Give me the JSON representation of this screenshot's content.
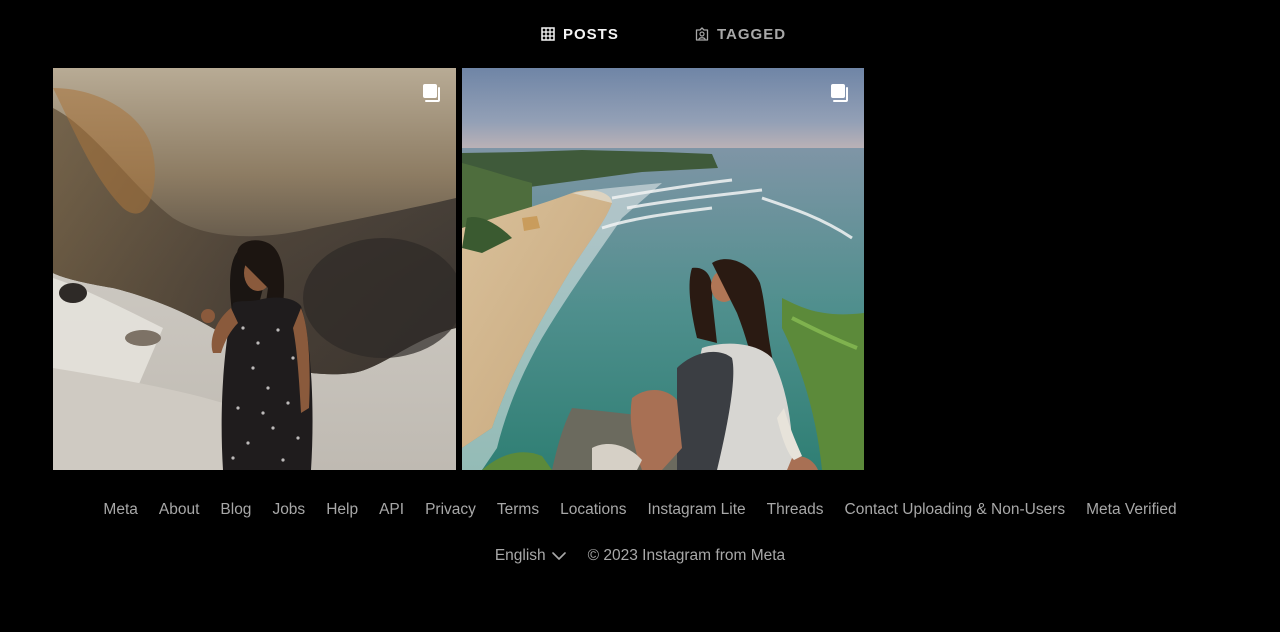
{
  "tabs": {
    "posts": {
      "label": "POSTS",
      "icon": "grid-icon"
    },
    "tagged": {
      "label": "TAGGED",
      "icon": "tagged-user-icon"
    }
  },
  "posts": [
    {
      "alt": "",
      "icon": "multiple-photos-icon"
    },
    {
      "alt": "",
      "icon": "multiple-photos-icon"
    }
  ],
  "footer": {
    "links": [
      "Meta",
      "About",
      "Blog",
      "Jobs",
      "Help",
      "API",
      "Privacy",
      "Terms",
      "Locations",
      "Instagram Lite",
      "Threads",
      "Contact Uploading & Non-Users",
      "Meta Verified"
    ],
    "language": "English",
    "copyright": "© 2023 Instagram from Meta"
  },
  "colors": {
    "background": "#000000",
    "text_primary": "#f5f5f5",
    "text_secondary": "#a8a8a8"
  }
}
